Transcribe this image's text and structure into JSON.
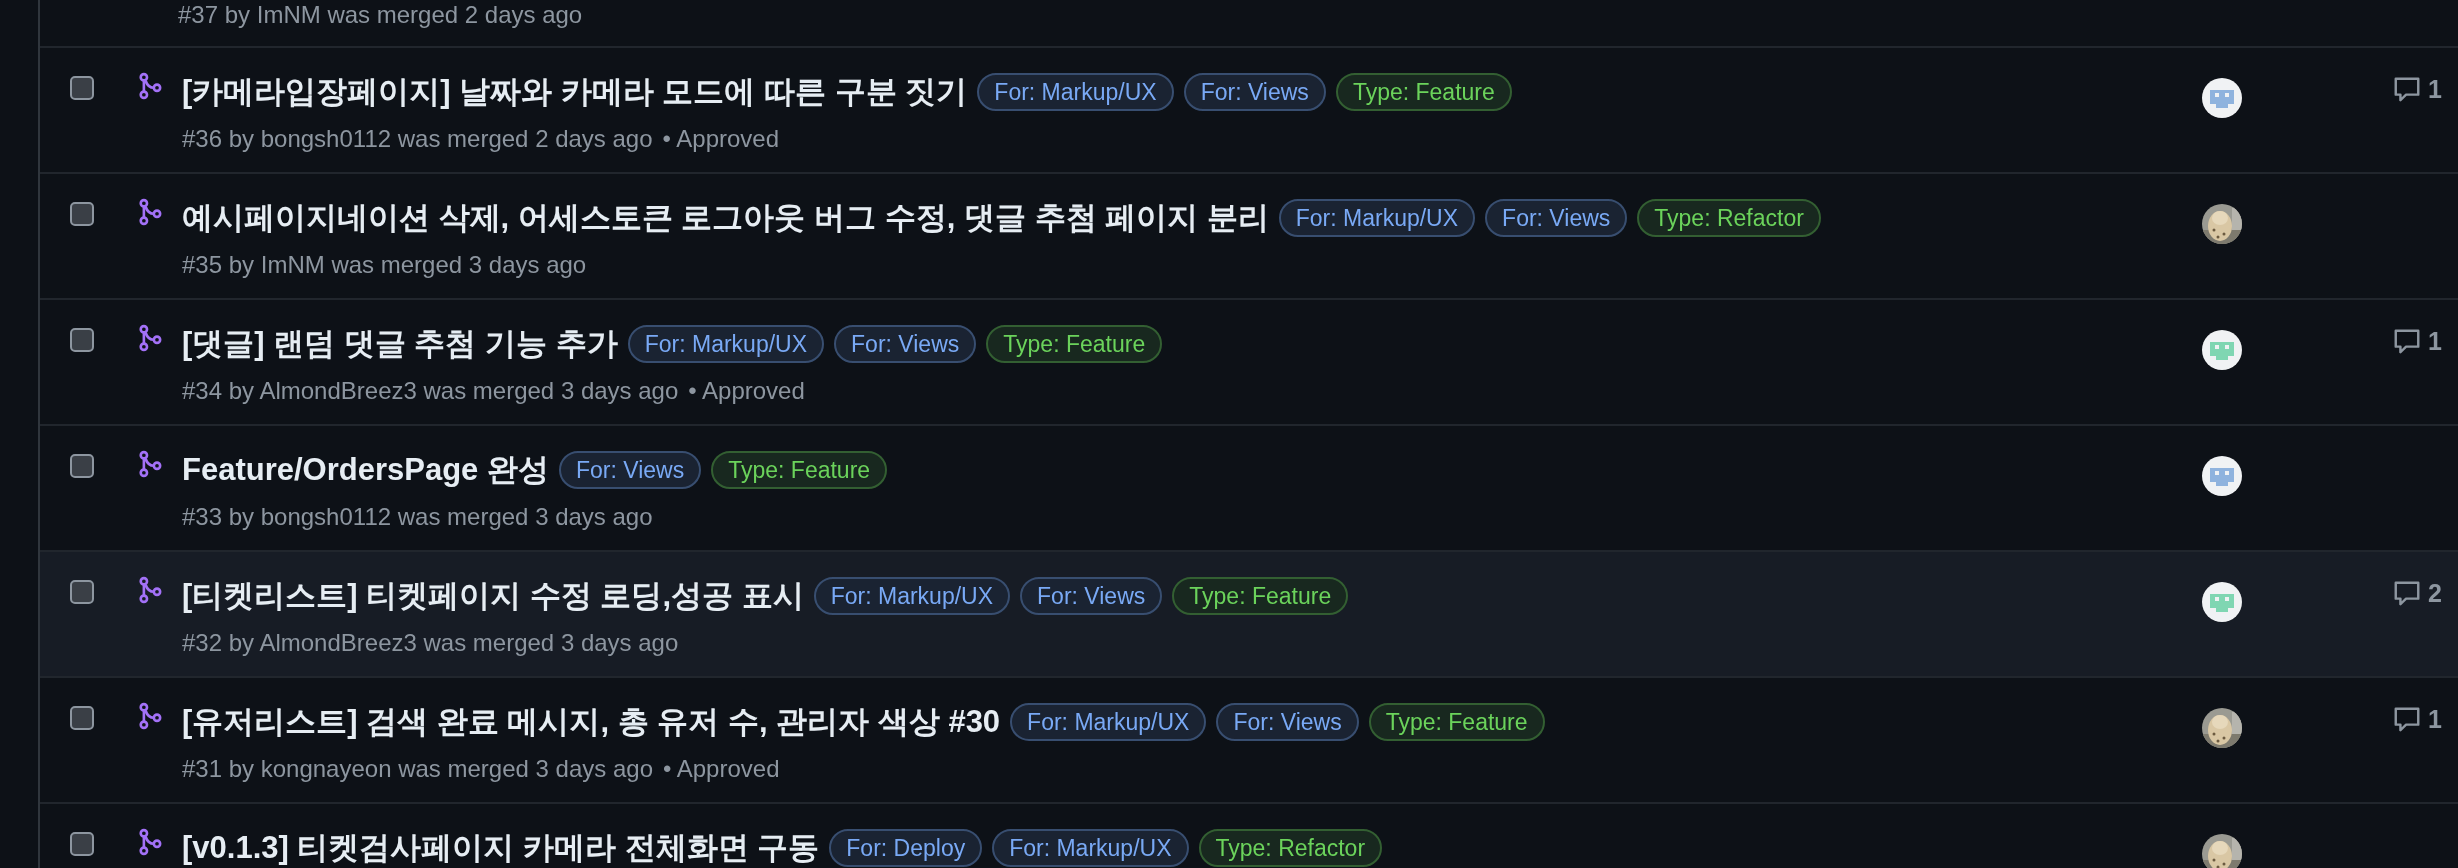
{
  "partial_row": {
    "meta": "#37 by ImNM was merged 2 days ago"
  },
  "pull_requests": [
    {
      "checked": false,
      "hovered": false,
      "title": "[카메라입장페이지] 날짜와 카메라 모드에 따른 구분 짓기",
      "labels": [
        {
          "text": "For: Markup/UX",
          "color": "#79a9f5"
        },
        {
          "text": "For: Views",
          "color": "#79a9f5"
        },
        {
          "text": "Type: Feature",
          "color": "#6bd35b"
        }
      ],
      "meta": "#36 by bongsh0112 was merged 2 days ago",
      "review": "• Approved",
      "avatar": {
        "kind": "identicon",
        "color": "#8fb3de"
      },
      "comments": "1"
    },
    {
      "checked": false,
      "hovered": false,
      "title": "예시페이지네이션 삭제, 어세스토큰 로그아웃 버그 수정, 댓글 추첨 페이지 분리",
      "labels": [
        {
          "text": "For: Markup/UX",
          "color": "#79a9f5"
        },
        {
          "text": "For: Views",
          "color": "#79a9f5"
        },
        {
          "text": "Type: Refactor",
          "color": "#6bd35b"
        }
      ],
      "meta": "#35 by ImNM was merged 3 days ago"
    },
    {
      "checked": false,
      "hovered": false,
      "title": "[댓글] 랜덤 댓글 추첨 기능 추가",
      "labels": [
        {
          "text": "For: Markup/UX",
          "color": "#79a9f5"
        },
        {
          "text": "For: Views",
          "color": "#79a9f5"
        },
        {
          "text": "Type: Feature",
          "color": "#6bd35b"
        }
      ],
      "meta": "#34 by AlmondBreez3 was merged 3 days ago",
      "review": "• Approved",
      "avatar": {
        "kind": "identicon",
        "color": "#7fd6b2"
      },
      "comments": "1"
    },
    {
      "checked": false,
      "hovered": false,
      "title": "Feature/OrdersPage 완성",
      "labels": [
        {
          "text": "For: Views",
          "color": "#79a9f5"
        },
        {
          "text": "Type: Feature",
          "color": "#6bd35b"
        }
      ],
      "meta": "#33 by bongsh0112 was merged 3 days ago",
      "avatar": {
        "kind": "identicon",
        "color": "#8fb3de"
      }
    },
    {
      "checked": false,
      "hovered": true,
      "title": "[티켓리스트] 티켓페이지 수정 로딩,성공 표시",
      "labels": [
        {
          "text": "For: Markup/UX",
          "color": "#79a9f5"
        },
        {
          "text": "For: Views",
          "color": "#79a9f5"
        },
        {
          "text": "Type: Feature",
          "color": "#6bd35b"
        }
      ],
      "meta": "#32 by AlmondBreez3 was merged 3 days ago",
      "avatar": {
        "kind": "identicon",
        "color": "#7fd6b2"
      },
      "comments": "2"
    },
    {
      "checked": false,
      "hovered": false,
      "title": "[유저리스트] 검색 완료 메시지, 총 유저 수, 관리자 색상 #30",
      "labels": [
        {
          "text": "For: Markup/UX",
          "color": "#79a9f5"
        },
        {
          "text": "For: Views",
          "color": "#79a9f5"
        },
        {
          "text": "Type: Feature",
          "color": "#6bd35b"
        }
      ],
      "meta": "#31 by kongnayeon was merged 3 days ago",
      "review": "• Approved",
      "comments": "1"
    },
    {
      "checked": false,
      "hovered": false,
      "title": "[v0.1.3] 티켓검사페이지 카메라 전체화면 구동",
      "labels": [
        {
          "text": "For: Deploy",
          "color": "#79a9f5"
        },
        {
          "text": "For: Markup/UX",
          "color": "#79a9f5"
        },
        {
          "text": "Type: Refactor",
          "color": "#6bd35b"
        }
      ]
    }
  ]
}
